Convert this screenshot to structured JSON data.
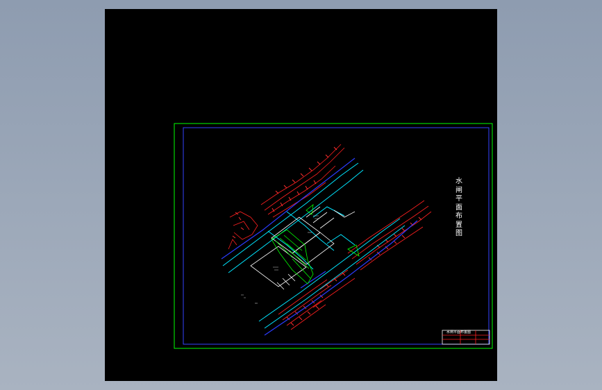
{
  "viewer": {
    "background": "#000000",
    "frame_color": "#00ff00",
    "inner_border_color": "#3344ff"
  },
  "drawing": {
    "title_chars": [
      "水",
      "闸",
      "平",
      "面",
      "布",
      "置",
      "图"
    ],
    "title_color": "#ffffff",
    "colors": {
      "terrain": "#ff2020",
      "waterline": "#00e5ff",
      "road": "#2b3cff",
      "hatch": "#00ff00",
      "structure": "#ffffff"
    },
    "title_block": {
      "caption": "水闸平面布置图"
    }
  }
}
